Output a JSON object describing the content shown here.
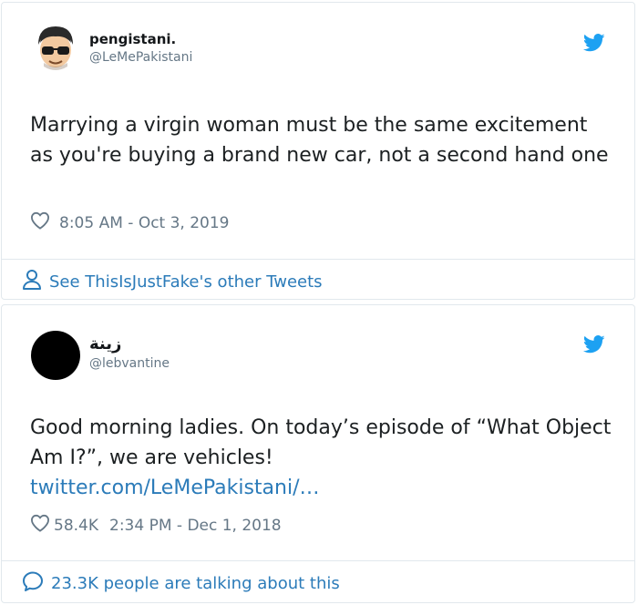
{
  "colors": {
    "brand": "#1da1f2",
    "link": "#2b7bb9",
    "muted": "#657786",
    "border": "#e1e8ed"
  },
  "tweet1": {
    "name": "pengistani.",
    "handle": "@LeMePakistani",
    "text": "Marrying a virgin woman must be the same excitement as you're buying a brand new car, not a second hand one",
    "like_icon": "heart-icon",
    "timestamp": "8:05 AM - Oct 3, 2019",
    "footer_icon": "person-icon",
    "footer_text": "See ThisIsJustFake's other Tweets"
  },
  "tweet2": {
    "name": "زينة",
    "handle": "@lebvantine",
    "text": "Good morning ladies. On today’s episode of “What Object Am I?”, we are vehicles!",
    "link": "twitter.com/LeMePakistani/…",
    "like_icon": "heart-icon",
    "likes": "58.4K",
    "timestamp": "2:34 PM - Dec 1, 2018",
    "footer_icon": "speech-bubble-icon",
    "footer_text": "23.3K people are talking about this"
  }
}
